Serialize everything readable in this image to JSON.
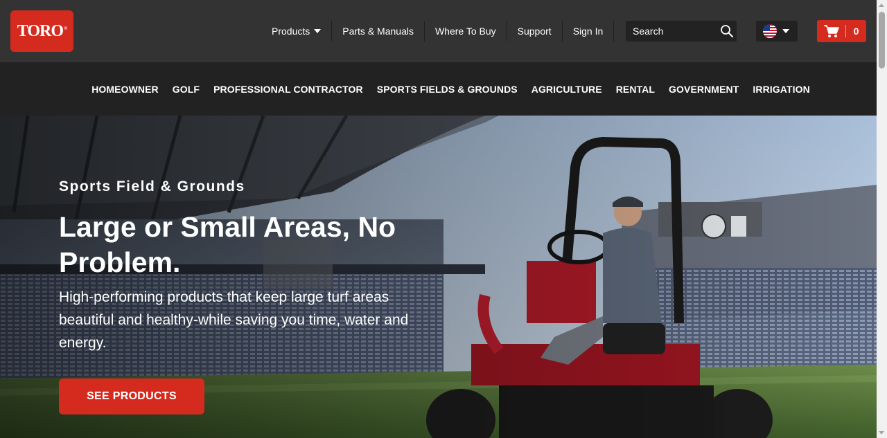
{
  "brand": {
    "logo_text": "TORO",
    "logo_mark": "®"
  },
  "utility_nav": [
    {
      "label": "Products"
    },
    {
      "label": "Parts & Manuals"
    },
    {
      "label": "Where To Buy"
    },
    {
      "label": "Support"
    },
    {
      "label": "Sign In"
    }
  ],
  "search": {
    "placeholder": "Search",
    "icon": "search-icon"
  },
  "locale": {
    "icon": "us-flag-icon"
  },
  "cart": {
    "count": "0",
    "icon": "cart-icon"
  },
  "category_nav": [
    {
      "label": "HOMEOWNER"
    },
    {
      "label": "GOLF"
    },
    {
      "label": "PROFESSIONAL CONTRACTOR"
    },
    {
      "label": "SPORTS FIELDS & GROUNDS"
    },
    {
      "label": "AGRICULTURE"
    },
    {
      "label": "RENTAL"
    },
    {
      "label": "GOVERNMENT"
    },
    {
      "label": "IRRIGATION"
    }
  ],
  "hero": {
    "eyebrow": "Sports Field & Grounds",
    "headline": "Large or Small Areas, No Problem.",
    "subtext": "High-performing products that keep large turf areas beautiful and healthy-while saving you time, water and energy.",
    "cta_label": "SEE PRODUCTS"
  },
  "colors": {
    "brand_red": "#d52b1e",
    "topbar": "#333333",
    "catnav": "#222222"
  }
}
